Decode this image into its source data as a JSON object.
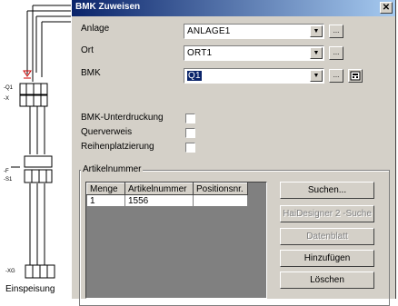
{
  "window": {
    "title": "BMK Zuweisen",
    "close_label": "✕"
  },
  "background": {
    "caption": "Einspeisung"
  },
  "fields": {
    "anlage": {
      "label": "Anlage",
      "value": "ANLAGE1"
    },
    "ort": {
      "label": "Ort",
      "value": "ORT1"
    },
    "bmk": {
      "label": "BMK",
      "value": "Q1"
    }
  },
  "browse_label": "...",
  "checkboxes": [
    {
      "label": "BMK-Unterdruckung",
      "checked": false
    },
    {
      "label": "Querverweis",
      "checked": false
    },
    {
      "label": "Reihenplatzierung",
      "checked": false
    }
  ],
  "group": {
    "label": "Artikelnummer"
  },
  "table": {
    "headers": [
      "Menge",
      "Artikelnummer",
      "Positionsnr."
    ],
    "rows": [
      [
        "1",
        "1556",
        ""
      ]
    ]
  },
  "buttons": {
    "search": "Suchen...",
    "haidesigner": "HaiDesigner 2 -Suche",
    "datasheet": "Datenblatt",
    "add": "Hinzufügen",
    "delete": "Löschen"
  },
  "icons": {
    "dropdown": "chevron-down-icon",
    "calculator": "calculator-icon",
    "close": "close-icon"
  }
}
